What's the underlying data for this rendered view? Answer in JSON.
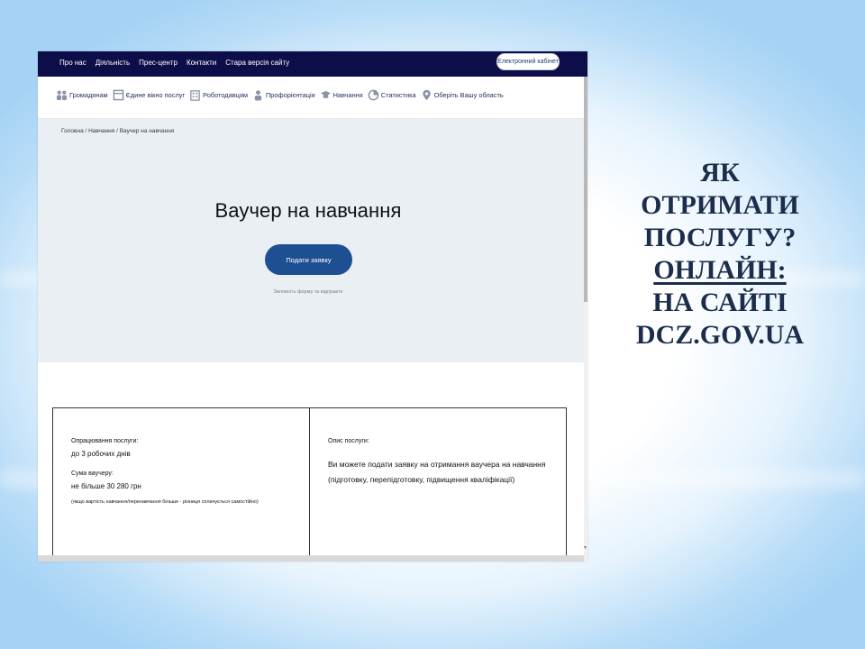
{
  "site": {
    "top_nav": [
      "Про нас",
      "Діяльність",
      "Прес-центр",
      "Контакти",
      "Стара версія сайту"
    ],
    "cabinet_button": "Електронний кабінет",
    "sections": [
      {
        "label": "Громадянам",
        "icon": "people-icon"
      },
      {
        "label": "Єдине вікно послуг",
        "icon": "window-icon"
      },
      {
        "label": "Роботодавцям",
        "icon": "building-icon"
      },
      {
        "label": "Профорієнтація",
        "icon": "person-icon"
      },
      {
        "label": "Навчання",
        "icon": "graduation-cap-icon"
      },
      {
        "label": "Статистика",
        "icon": "pie-chart-icon"
      },
      {
        "label": "Оберіть Вашу область",
        "icon": "location-pin-icon"
      }
    ],
    "breadcrumb": "Головна / Навчання / Ваучер на навчання",
    "hero_title": "Ваучер на навчання",
    "apply_button": "Подати заявку",
    "apply_hint": "Заповніть форму та відправте",
    "processing_label": "Опрацювання послуги:",
    "processing_value": "до 3 робочих днів",
    "amount_label": "Сума ваучеру:",
    "amount_value": "не більше 30 280 грн",
    "amount_note": "(якщо вартість навчання/перенавчання більше - різниця сплачується самостійно)",
    "description_label": "Опис послуги:",
    "description_text": "Ви можете подати заявку на отримання ваучера на навчання (підготовку, перепідготовку, підвищення кваліфікації)"
  },
  "heading": {
    "line1": "ЯК",
    "line2": "ОТРИМАТИ",
    "line3": "ПОСЛУГУ?",
    "line4": "ОНЛАЙН:",
    "line5": "НА САЙТІ",
    "line6": "DCZ.GOV.UA"
  },
  "colors": {
    "nav_bar": "#0d0d4a",
    "button": "#1f4f93",
    "heading": "#1b2d4a",
    "hero_bg": "#e9eff3"
  }
}
